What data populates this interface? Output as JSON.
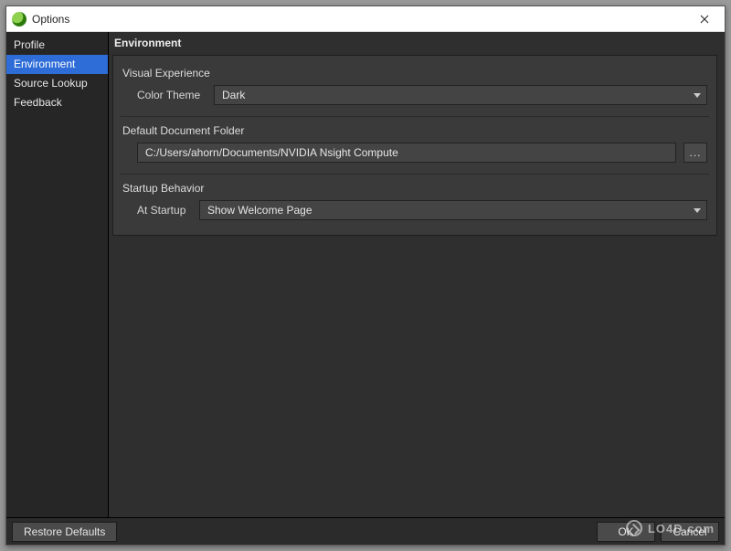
{
  "window": {
    "title": "Options"
  },
  "sidebar": {
    "items": [
      {
        "label": "Profile",
        "selected": false
      },
      {
        "label": "Environment",
        "selected": true
      },
      {
        "label": "Source Lookup",
        "selected": false
      },
      {
        "label": "Feedback",
        "selected": false
      }
    ]
  },
  "main": {
    "heading": "Environment",
    "sections": {
      "visual": {
        "title": "Visual Experience",
        "color_theme_label": "Color Theme",
        "color_theme_value": "Dark"
      },
      "docfolder": {
        "title": "Default Document Folder",
        "path": "C:/Users/ahorn/Documents/NVIDIA Nsight Compute",
        "browse_label": "..."
      },
      "startup": {
        "title": "Startup Behavior",
        "at_startup_label": "At Startup",
        "at_startup_value": "Show Welcome Page"
      }
    }
  },
  "footer": {
    "restore_label": "Restore Defaults",
    "ok_label": "OK",
    "cancel_label": "Cancel"
  },
  "watermark": "LO4D.com"
}
